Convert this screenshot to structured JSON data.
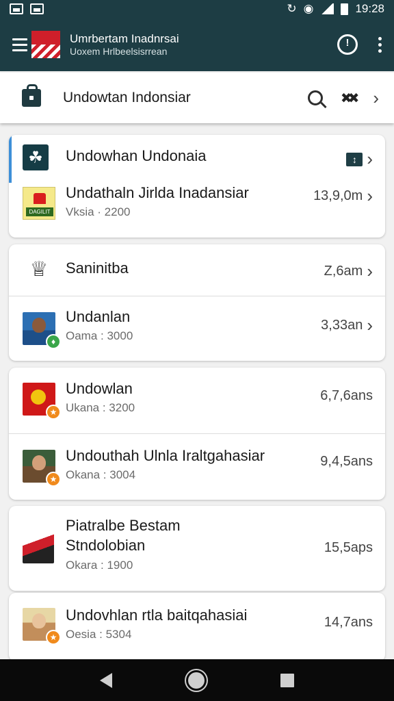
{
  "status_bar": {
    "time": "19:28"
  },
  "app_bar": {
    "title": "Umrbertam Inadnrsai",
    "subtitle": "Uoxem Hrlbeelsisrrean"
  },
  "search_bar": {
    "title": "Undowtan Indonsiar"
  },
  "cards": [
    {
      "rows": [
        {
          "name": "Undowhan Undonaia",
          "meta": "",
          "icon": "leaf-icon"
        },
        {
          "name": "Undathaln Jirlda Inadansiar",
          "sub": "Vksia · 2200",
          "meta": "13,9,0m",
          "icon": "flag-hat-icon",
          "icon_text": "DAGILIT"
        }
      ]
    },
    {
      "rows": [
        {
          "name": "Saninitba",
          "meta": "Z,6am",
          "icon": "figure-icon"
        },
        {
          "name": "Undanlan",
          "sub": "Oama : 3000",
          "meta": "3,33an",
          "icon": "avatar-icon"
        }
      ]
    },
    {
      "rows": [
        {
          "name": "Undowlan",
          "sub": "Ukana : 3200",
          "meta": "6,7,6ans",
          "icon": "avatar-icon"
        },
        {
          "name": "Undouthah Ulnla Iraltgahasiar",
          "sub": "Okana : 3004",
          "meta": "9,4,5ans",
          "icon": "avatar-icon"
        }
      ]
    },
    {
      "rows": [
        {
          "name": "Piatralbe Bestam",
          "name2": "Stndolobian",
          "sub": "Okara : 1900",
          "meta": "15,5aps",
          "icon": "flag-icon"
        }
      ]
    },
    {
      "rows": [
        {
          "name": "Undovhlan  rtla baitqahasiai",
          "sub": "Oesia : 5304",
          "meta": "14,7ans",
          "icon": "avatar-icon"
        }
      ]
    }
  ],
  "colors": {
    "app_bar": "#1d3d44",
    "accent": "#3d8fd8",
    "badge_green": "#3aa64a",
    "badge_orange": "#f08a1c"
  }
}
